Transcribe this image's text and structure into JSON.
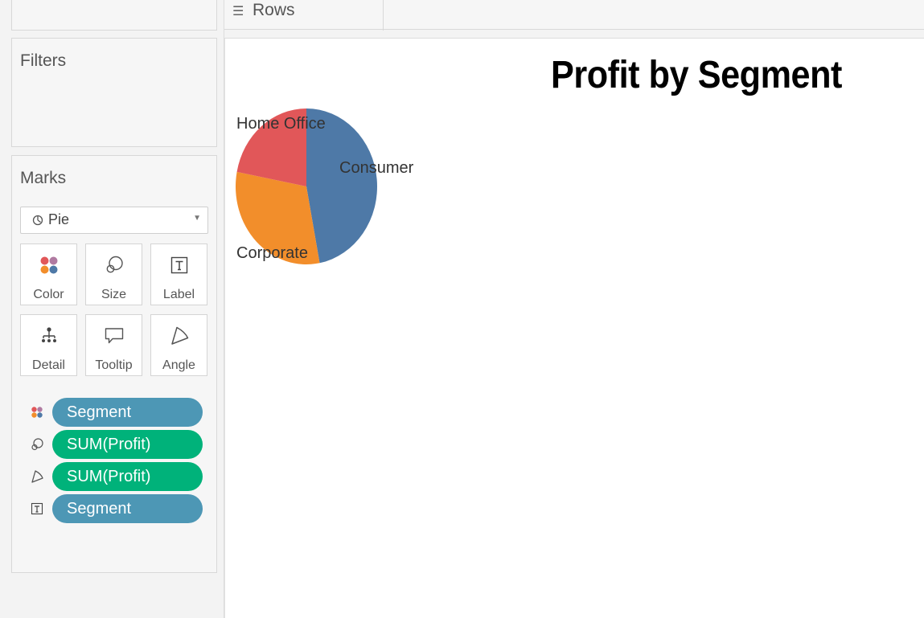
{
  "shelves": {
    "rows_label": "Rows"
  },
  "filters": {
    "title": "Filters"
  },
  "marks": {
    "title": "Marks",
    "mark_type": "Pie",
    "buttons": {
      "color": "Color",
      "size": "Size",
      "label": "Label",
      "detail": "Detail",
      "tooltip": "Tooltip",
      "angle": "Angle"
    },
    "pills": [
      {
        "encoding": "color",
        "field": "Segment",
        "kind": "dimension"
      },
      {
        "encoding": "size",
        "field": "SUM(Profit)",
        "kind": "measure"
      },
      {
        "encoding": "angle",
        "field": "SUM(Profit)",
        "kind": "measure"
      },
      {
        "encoding": "label",
        "field": "Segment",
        "kind": "dimension"
      }
    ]
  },
  "colors": {
    "dimension_pill": "#4d97b5",
    "measure_pill": "#00b27a"
  },
  "chart_data": {
    "type": "pie",
    "title": "Profit by Segment",
    "categories": [
      "Consumer",
      "Corporate",
      "Home Office"
    ],
    "values": [
      47,
      31,
      22
    ],
    "colors": [
      "#4e79a7",
      "#f28e2b",
      "#e15759"
    ]
  }
}
